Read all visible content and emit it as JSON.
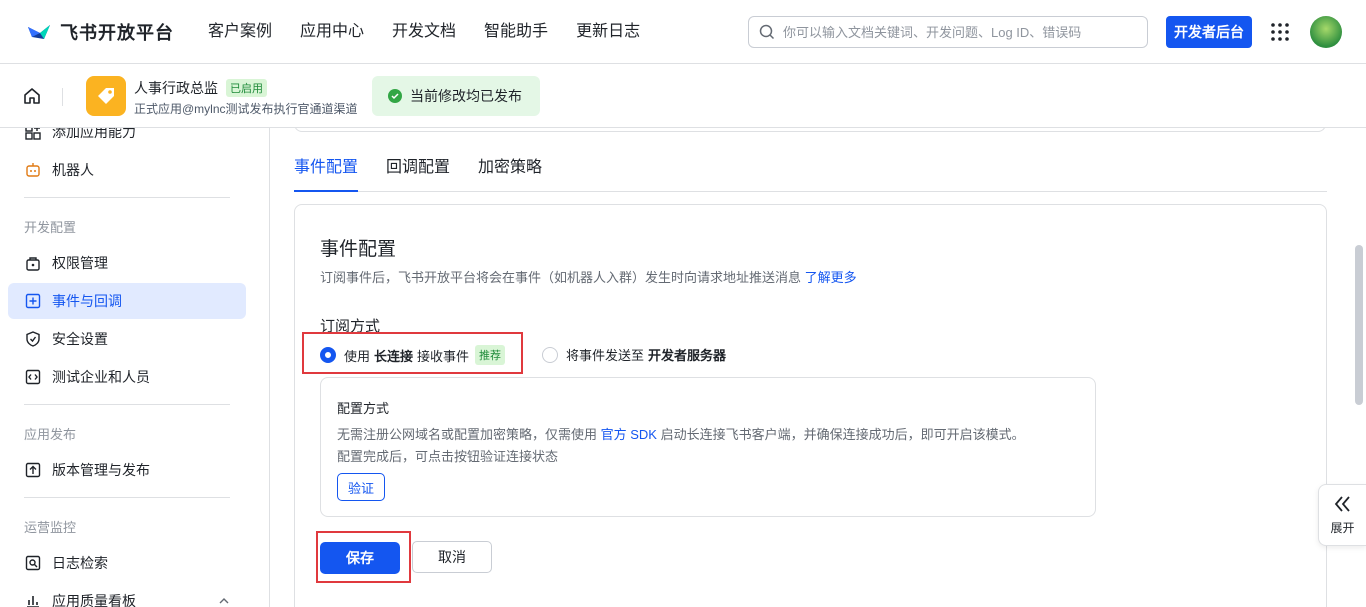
{
  "brand": {
    "name": "飞书开放平台"
  },
  "nav": [
    "客户案例",
    "应用中心",
    "开发文档",
    "智能助手",
    "更新日志"
  ],
  "search": {
    "placeholder": "你可以输入文档关键词、开发问题、Log ID、错误码"
  },
  "header": {
    "dev_console": "开发者后台"
  },
  "app": {
    "name": "人事行政总监",
    "status": "已启用",
    "subtitle": "正式应用@mylnc测试发布执行官通道渠道",
    "publish_status": "当前修改均已发布"
  },
  "sidebar": {
    "top_items": [
      {
        "label": "添加应用能力",
        "icon": "add-capability-icon"
      },
      {
        "label": "机器人",
        "icon": "robot-icon"
      }
    ],
    "groups": [
      {
        "title": "开发配置",
        "items": [
          {
            "label": "权限管理",
            "icon": "permission-icon"
          },
          {
            "label": "事件与回调",
            "icon": "event-icon",
            "active": true
          },
          {
            "label": "安全设置",
            "icon": "shield-icon"
          },
          {
            "label": "测试企业和人员",
            "icon": "test-icon"
          }
        ]
      },
      {
        "title": "应用发布",
        "items": [
          {
            "label": "版本管理与发布",
            "icon": "upload-icon"
          }
        ]
      },
      {
        "title": "运营监控",
        "items": [
          {
            "label": "日志检索",
            "icon": "log-search-icon"
          },
          {
            "label": "应用质量看板",
            "icon": "quality-chart-icon"
          }
        ]
      }
    ]
  },
  "tabs": [
    {
      "label": "事件配置",
      "active": true
    },
    {
      "label": "回调配置"
    },
    {
      "label": "加密策略"
    }
  ],
  "event_config": {
    "title": "事件配置",
    "desc": "订阅事件后，飞书开放平台将会在事件（如机器人入群）发生时向请求地址推送消息",
    "learn_more": "了解更多",
    "subscribe_label": "订阅方式",
    "option1": {
      "prefix": "使用",
      "bold": "长连接",
      "suffix": "接收事件",
      "tag": "推荐",
      "selected": true
    },
    "option2": {
      "prefix": "将事件发送至",
      "bold": "开发者服务器",
      "selected": false
    },
    "config": {
      "title": "配置方式",
      "desc_pre": "无需注册公网域名或配置加密策略，仅需使用",
      "desc_link": "官方 SDK",
      "desc_post": "启动长连接飞书客户端，并确保连接成功后，即可开启该模式。",
      "desc_line2": "配置完成后，可点击按钮验证连接状态",
      "verify": "验证"
    },
    "save": "保存",
    "cancel": "取消"
  },
  "expand_label": "展开",
  "colors": {
    "primary": "#1456f0",
    "highlight": "#e0393e",
    "success": "#32a645"
  }
}
